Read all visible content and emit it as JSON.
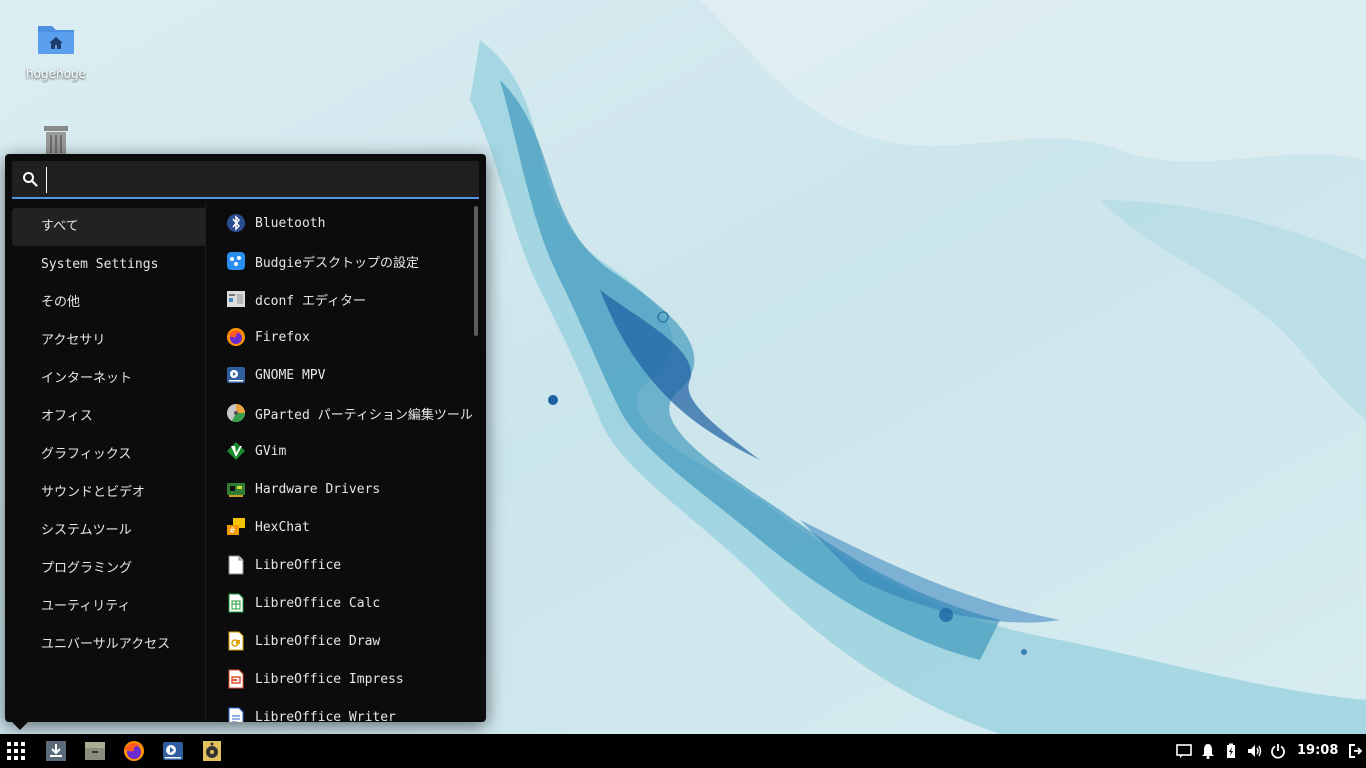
{
  "desktop": {
    "home_label": "hogehoge"
  },
  "menu": {
    "search_placeholder": "",
    "categories": [
      {
        "label": "すべて",
        "active": true
      },
      {
        "label": "System Settings"
      },
      {
        "label": "その他"
      },
      {
        "label": "アクセサリ"
      },
      {
        "label": "インターネット"
      },
      {
        "label": "オフィス"
      },
      {
        "label": "グラフィックス"
      },
      {
        "label": "サウンドとビデオ"
      },
      {
        "label": "システムツール"
      },
      {
        "label": "プログラミング"
      },
      {
        "label": "ユーティリティ"
      },
      {
        "label": "ユニバーサルアクセス"
      }
    ],
    "apps": [
      {
        "label": "Bluetooth",
        "icon": "bluetooth-icon"
      },
      {
        "label": "Budgieデスクトップの設定",
        "icon": "budgie-settings-icon"
      },
      {
        "label": "dconf エディター",
        "icon": "dconf-editor-icon"
      },
      {
        "label": "Firefox",
        "icon": "firefox-icon"
      },
      {
        "label": "GNOME MPV",
        "icon": "gnome-mpv-icon"
      },
      {
        "label": "GParted パーティション編集ツール",
        "icon": "gparted-icon"
      },
      {
        "label": "GVim",
        "icon": "gvim-icon"
      },
      {
        "label": "Hardware Drivers",
        "icon": "hardware-drivers-icon"
      },
      {
        "label": "HexChat",
        "icon": "hexchat-icon"
      },
      {
        "label": "LibreOffice",
        "icon": "libreoffice-icon"
      },
      {
        "label": "LibreOffice Calc",
        "icon": "libreoffice-calc-icon"
      },
      {
        "label": "LibreOffice Draw",
        "icon": "libreoffice-draw-icon"
      },
      {
        "label": "LibreOffice Impress",
        "icon": "libreoffice-impress-icon"
      },
      {
        "label": "LibreOffice Writer",
        "icon": "libreoffice-writer-icon"
      }
    ]
  },
  "panel": {
    "clock": "19:08"
  },
  "colors": {
    "accent": "#5294e2",
    "menu_bg": "#0c0c0d",
    "panel_bg": "#000000"
  }
}
